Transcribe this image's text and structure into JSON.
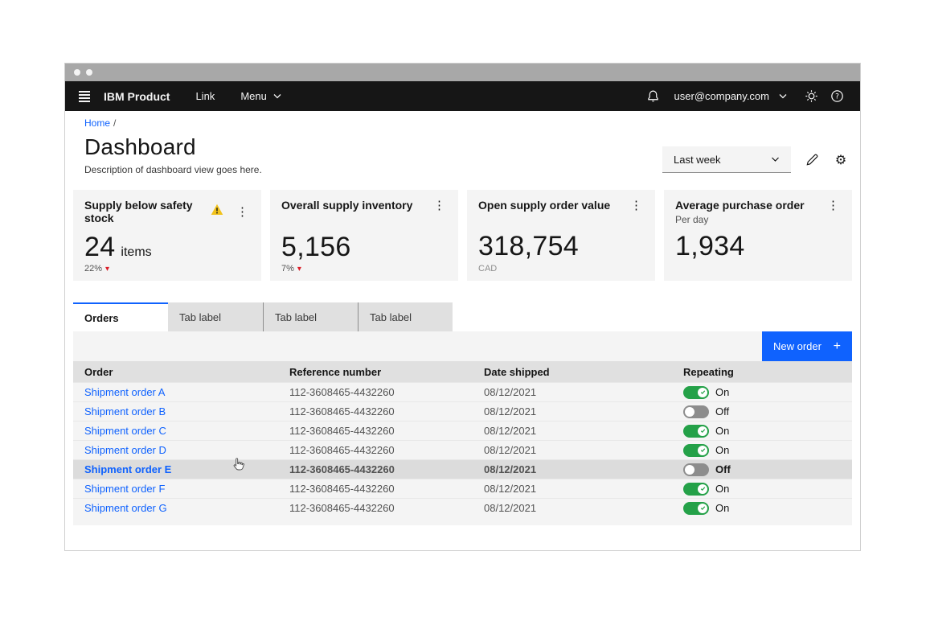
{
  "header": {
    "product": "IBM Product",
    "link_label": "Link",
    "menu_label": "Menu",
    "account": "user@company.com"
  },
  "breadcrumb": {
    "home": "Home"
  },
  "page": {
    "title": "Dashboard",
    "description": "Description of dashboard view goes here."
  },
  "filter": {
    "value": "Last week"
  },
  "cards": [
    {
      "title": "Supply below safety stock",
      "value": "24",
      "unit": "items",
      "trend": "22%",
      "has_warning": true
    },
    {
      "title": "Overall supply inventory",
      "value": "5,156",
      "trend": "7%"
    },
    {
      "title": "Open supply order value",
      "value": "318,754",
      "below_label": "CAD"
    },
    {
      "title": "Average purchase order",
      "subtitle": "Per day",
      "value": "1,934"
    }
  ],
  "tabs": [
    {
      "label": "Orders",
      "state": "active"
    },
    {
      "label": "Tab label"
    },
    {
      "label": "Tab label"
    },
    {
      "label": "Tab label"
    }
  ],
  "table": {
    "new_order_label": "New order",
    "columns": {
      "order": "Order",
      "reference": "Reference number",
      "date": "Date shipped",
      "repeating": "Repeating"
    },
    "rows": [
      {
        "order": "Shipment order A",
        "reference": "112-3608465-4432260",
        "date": "08/12/2021",
        "state": "on",
        "toggle_label": "On"
      },
      {
        "order": "Shipment order B",
        "reference": "112-3608465-4432260",
        "date": "08/12/2021",
        "state": "off",
        "toggle_label": "Off"
      },
      {
        "order": "Shipment order C",
        "reference": "112-3608465-4432260",
        "date": "08/12/2021",
        "state": "on",
        "toggle_label": "On"
      },
      {
        "order": "Shipment order D",
        "reference": "112-3608465-4432260",
        "date": "08/12/2021",
        "state": "on",
        "toggle_label": "On"
      },
      {
        "order": "Shipment order E",
        "reference": "112-3608465-4432260",
        "date": "08/12/2021",
        "state": "off",
        "toggle_label": "Off",
        "row_class": "hovered"
      },
      {
        "order": "Shipment order F",
        "reference": "112-3608465-4432260",
        "date": "08/12/2021",
        "state": "on",
        "toggle_label": "On"
      },
      {
        "order": "Shipment order G",
        "reference": "112-3608465-4432260",
        "date": "08/12/2021",
        "state": "on",
        "toggle_label": "On"
      }
    ]
  },
  "icons": {
    "overflow": "⋮",
    "plus": "+",
    "trend_down": "▾",
    "gear": "⚙",
    "breadcrumb_separator": "/"
  },
  "colors": {
    "accent_blue": "#0f62fe",
    "header_bg": "#161616",
    "toggle_on_green": "#24a148",
    "warning_yellow": "#f1c21b",
    "trend_down_red": "#da1e28",
    "card_bg": "#f4f4f4"
  }
}
